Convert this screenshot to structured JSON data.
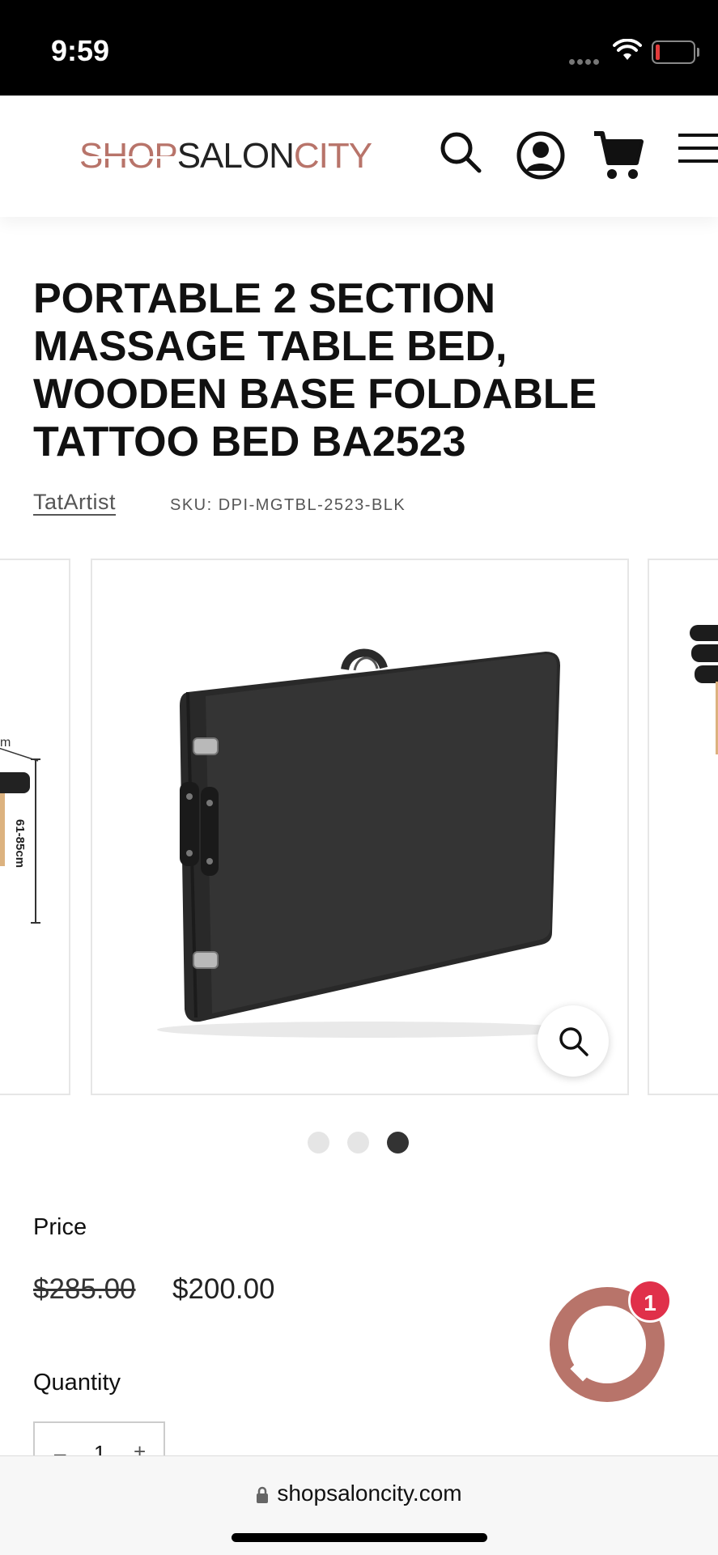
{
  "status_bar": {
    "time": "9:59"
  },
  "header": {
    "logo": {
      "shop": "SHOP",
      "salon": "SALON",
      "city": "CITY"
    }
  },
  "product": {
    "title": "PORTABLE 2 SECTION MASSAGE TABLE BED, WOODEN BASE FOLDABLE TATTOO BED BA2523",
    "vendor": "TatArtist",
    "sku": "SKU: DPI-MGTBL-2523-BLK",
    "gallery": {
      "prev_image_label": "61-85cm",
      "slide_count": 3,
      "active_slide": 3
    },
    "price_label": "Price",
    "compare_price": "$285.00",
    "price": "$200.00",
    "quantity_label": "Quantity",
    "quantity_value": "1",
    "quantity_minus": "–",
    "quantity_plus": "+"
  },
  "chat": {
    "badge_count": "1"
  },
  "browser": {
    "url": "shopsaloncity.com"
  },
  "colors": {
    "brand": "#b8746a",
    "badge": "#e0304a"
  }
}
